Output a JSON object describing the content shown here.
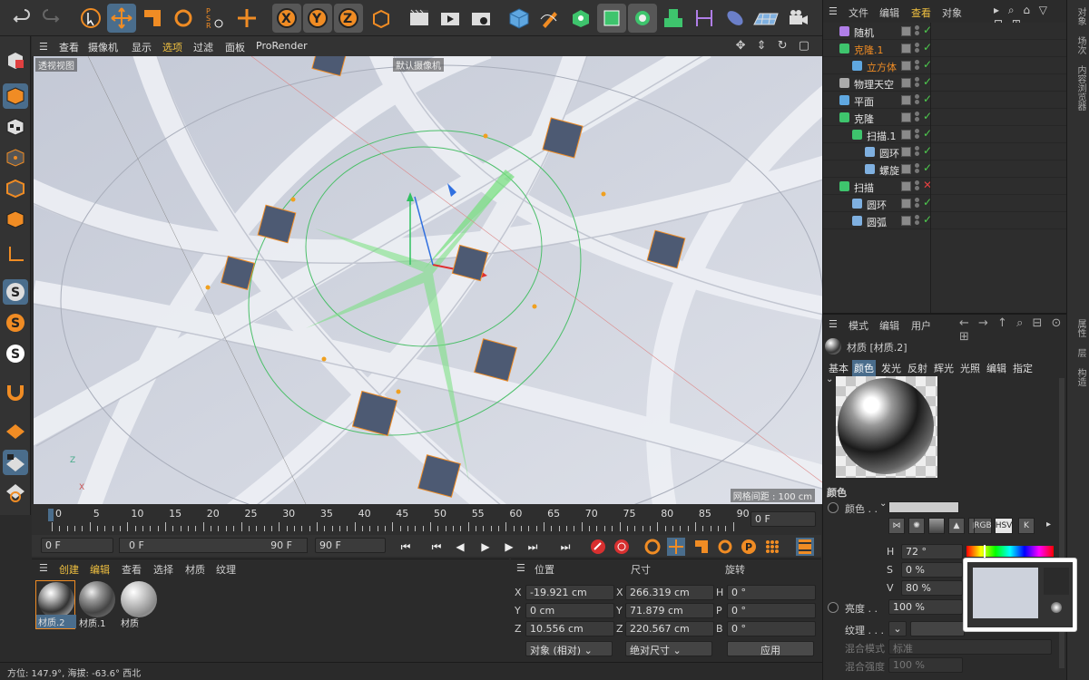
{
  "viewport": {
    "menu": [
      "查看",
      "摄像机",
      "显示",
      "选项",
      "过滤",
      "面板",
      "ProRender"
    ],
    "view_label": "透视视图",
    "camera_label": "默认摄像机",
    "grid_label": "网格间距 : 100 cm"
  },
  "timeline": {
    "ticks": [
      "0",
      "5",
      "10",
      "15",
      "20",
      "25",
      "30",
      "35",
      "40",
      "45",
      "50",
      "55",
      "60",
      "65",
      "70",
      "75",
      "80",
      "85",
      "90"
    ],
    "end_field": "0 F",
    "current_frame": "0 F",
    "range_start": "0 F",
    "range_end": "90 F",
    "max_frame": "90 F"
  },
  "material_manager": {
    "menu": [
      "创建",
      "编辑",
      "查看",
      "选择",
      "材质",
      "纹理"
    ],
    "materials": [
      {
        "name": "材质.2"
      },
      {
        "name": "材质.1"
      },
      {
        "name": "材质"
      }
    ]
  },
  "coordinates": {
    "headers": {
      "position": "位置",
      "size": "尺寸",
      "rotation": "旋转"
    },
    "rows": [
      {
        "axis": "X",
        "pos": "-19.921 cm",
        "size_axis": "X",
        "size": "266.319 cm",
        "rot_axis": "H",
        "rot": "0 °"
      },
      {
        "axis": "Y",
        "pos": "0 cm",
        "size_axis": "Y",
        "size": "71.879 cm",
        "rot_axis": "P",
        "rot": "0 °"
      },
      {
        "axis": "Z",
        "pos": "10.556 cm",
        "size_axis": "Z",
        "size": "220.567 cm",
        "rot_axis": "B",
        "rot": "0 °"
      }
    ],
    "mode": "对象 (相对)",
    "size_mode": "绝对尺寸",
    "apply": "应用"
  },
  "status": "方位: 147.9°, 海拔: -63.6° 西北",
  "object_manager": {
    "menu": [
      "文件",
      "编辑",
      "查看",
      "对象"
    ],
    "objects": [
      {
        "name": "随机",
        "indent": 0,
        "icon": "effector"
      },
      {
        "name": "克隆.1",
        "indent": 0,
        "icon": "cloner",
        "active": true
      },
      {
        "name": "立方体",
        "indent": 1,
        "icon": "cube",
        "active": true
      },
      {
        "name": "物理天空",
        "indent": 0,
        "icon": "sky"
      },
      {
        "name": "平面",
        "indent": 0,
        "icon": "plane"
      },
      {
        "name": "克隆",
        "indent": 0,
        "icon": "cloner"
      },
      {
        "name": "扫描.1",
        "indent": 1,
        "icon": "sweep"
      },
      {
        "name": "圆环",
        "indent": 2,
        "icon": "circle"
      },
      {
        "name": "螺旋",
        "indent": 2,
        "icon": "helix"
      },
      {
        "name": "扫描",
        "indent": 0,
        "icon": "sweep"
      },
      {
        "name": "圆环",
        "indent": 1,
        "icon": "circle"
      },
      {
        "name": "圆弧",
        "indent": 1,
        "icon": "arc"
      }
    ]
  },
  "attribute_manager": {
    "menu": [
      "模式",
      "编辑",
      "用户"
    ],
    "title": "材质 [材质.2]",
    "tabs": [
      "基本",
      "颜色",
      "发光",
      "反射",
      "辉光",
      "光照",
      "编辑",
      "指定"
    ],
    "selected_tab": "颜色",
    "section": "颜色",
    "color_label": "颜色 . .",
    "color_modes": [
      "RGB",
      "HSV",
      "K"
    ],
    "hsv": {
      "h_label": "H",
      "h": "72 °",
      "s_label": "S",
      "s": "0 %",
      "v_label": "V",
      "v": "80 %"
    },
    "brightness_label": "亮度 . .",
    "brightness": "100 %",
    "texture_label": "纹理 . . .",
    "blend_mode_label": "混合模式",
    "blend_mode": "标准",
    "blend_strength_label": "混合强度",
    "blend_strength": "100 %"
  },
  "right_strip": {
    "top": [
      "对象",
      "场次",
      "内容浏览器"
    ],
    "bottom": [
      "属性",
      "层",
      "构造"
    ]
  },
  "colors": {
    "accent": "#4a6d8c",
    "orange": "#f08c24",
    "green": "#4ecb4e"
  }
}
